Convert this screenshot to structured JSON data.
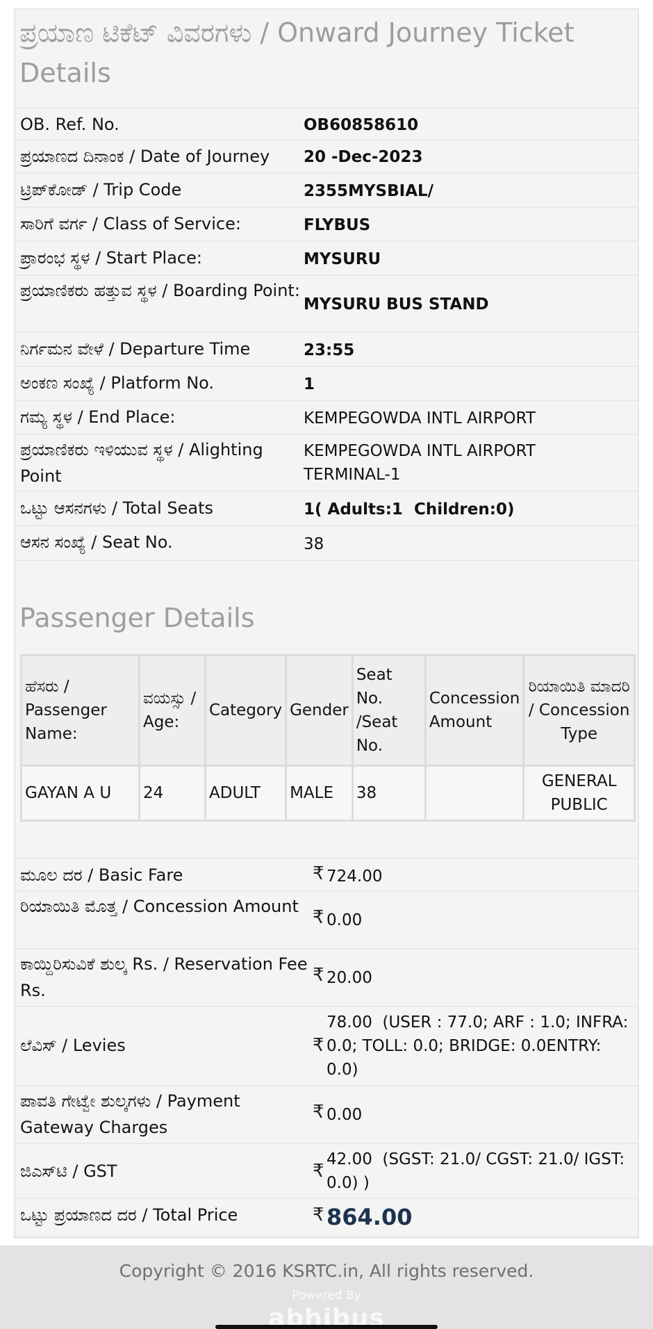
{
  "page": {
    "title": "ಪ್ರಯಾಣ ಟಿಕೆಟ್ ವಿವರಗಳು / Onward Journey Ticket Details"
  },
  "journey": [
    {
      "label": "OB. Ref. No.",
      "value": "OB60858610"
    },
    {
      "label": "ಪ್ರಯಾಣದ ದಿನಾಂಕ / Date of Journey",
      "value": "20 -Dec-2023"
    },
    {
      "label": "ಟ್ರಿಪ್‌ಕೋಡ್ / Trip Code",
      "value": "2355MYSBIAL/"
    },
    {
      "label": "ಸಾರಿಗೆ ವರ್ಗ / Class of Service:",
      "value": "FLYBUS"
    },
    {
      "label": "ಪ್ರಾರಂಭ ಸ್ಥಳ / Start Place:",
      "value": "MYSURU"
    },
    {
      "label": "ಪ್ರಯಾಣಿಕರು ಹತ್ತುವ ಸ್ಥಳ / Boarding Point:",
      "value": "MYSURU BUS STAND"
    },
    {
      "label": "ನಿರ್ಗಮನ ವೇಳೆ / Departure Time",
      "value": "23:55"
    },
    {
      "label": "ಅಂಕಣ ಸಂಖ್ಯೆ / Platform No.",
      "value": "1"
    },
    {
      "label": "ಗಮ್ಯ ಸ್ಥಳ / End Place:",
      "value": "KEMPEGOWDA INTL AIRPORT"
    },
    {
      "label": "ಪ್ರಯಾಣಿಕರು ಇಳಿಯುವ ಸ್ಥಳ / Alighting Point",
      "value": "KEMPEGOWDA INTL AIRPORT TERMINAL-1"
    },
    {
      "label": "ಒಟ್ಟು ಆಸನಗಳು / Total Seats",
      "value": "1( Adults:1  Children:0)"
    },
    {
      "label": "ಆಸನ ಸಂಖ್ಯೆ / Seat No.",
      "value": "38"
    }
  ],
  "passengers": {
    "title": "Passenger Details",
    "headers": [
      "ಹೆಸರು / Passenger Name:",
      "ವಯಸ್ಸು / Age:",
      "Category",
      "Gender",
      "Seat No. /Seat No.",
      "Concession Amount",
      "ರಿಯಾಯಿತಿ ಮಾದರಿ / Concession Type"
    ],
    "rows": [
      {
        "name": "GAYAN A U",
        "age": "24",
        "category": "ADULT",
        "gender": "MALE",
        "seat": "38",
        "concession_amount": "",
        "concession_type": "GENERAL PUBLIC"
      }
    ]
  },
  "fare": {
    "currency_symbol": "₹",
    "items": [
      {
        "label": "ಮೂಲ ದರ / Basic Fare",
        "value": "724.00"
      },
      {
        "label": "ರಿಯಾಯಿತಿ ಮೊತ್ತ / Concession Amount",
        "value": "0.00"
      },
      {
        "label": "ಕಾಯ್ದಿರಿಸುವಿಕೆ ಶುಲ್ಕ Rs. / Reservation Fee Rs.",
        "value": "20.00"
      },
      {
        "label": "ಲೆವಿಸ್ / Levies",
        "value": "78.00  (USER : 77.0; ARF : 1.0; INFRA: 0.0; TOLL: 0.0; BRIDGE: 0.0ENTRY: 0.0)"
      },
      {
        "label": "ಪಾವತಿ ಗೇಟ್ವೇ ಶುಲ್ಕಗಳು / Payment Gateway Charges",
        "value": "0.00"
      },
      {
        "label": "ಜಿಎಸ್‌ಟಿ / GST",
        "value": "42.00  (SGST: 21.0/ CGST: 21.0/ IGST: 0.0) )"
      },
      {
        "label": "ಒಟ್ಟು ಪ್ರಯಾಣದ ದರ / Total Price",
        "value": "864.00"
      }
    ]
  },
  "footer": {
    "copyright": "Copyright © 2016 KSRTC.in, All rights reserved.",
    "powered_by": "Powered By",
    "brand": "abhibus"
  },
  "colors": {
    "total_price": "#1c3350",
    "muted_heading": "#9d9d9d"
  }
}
